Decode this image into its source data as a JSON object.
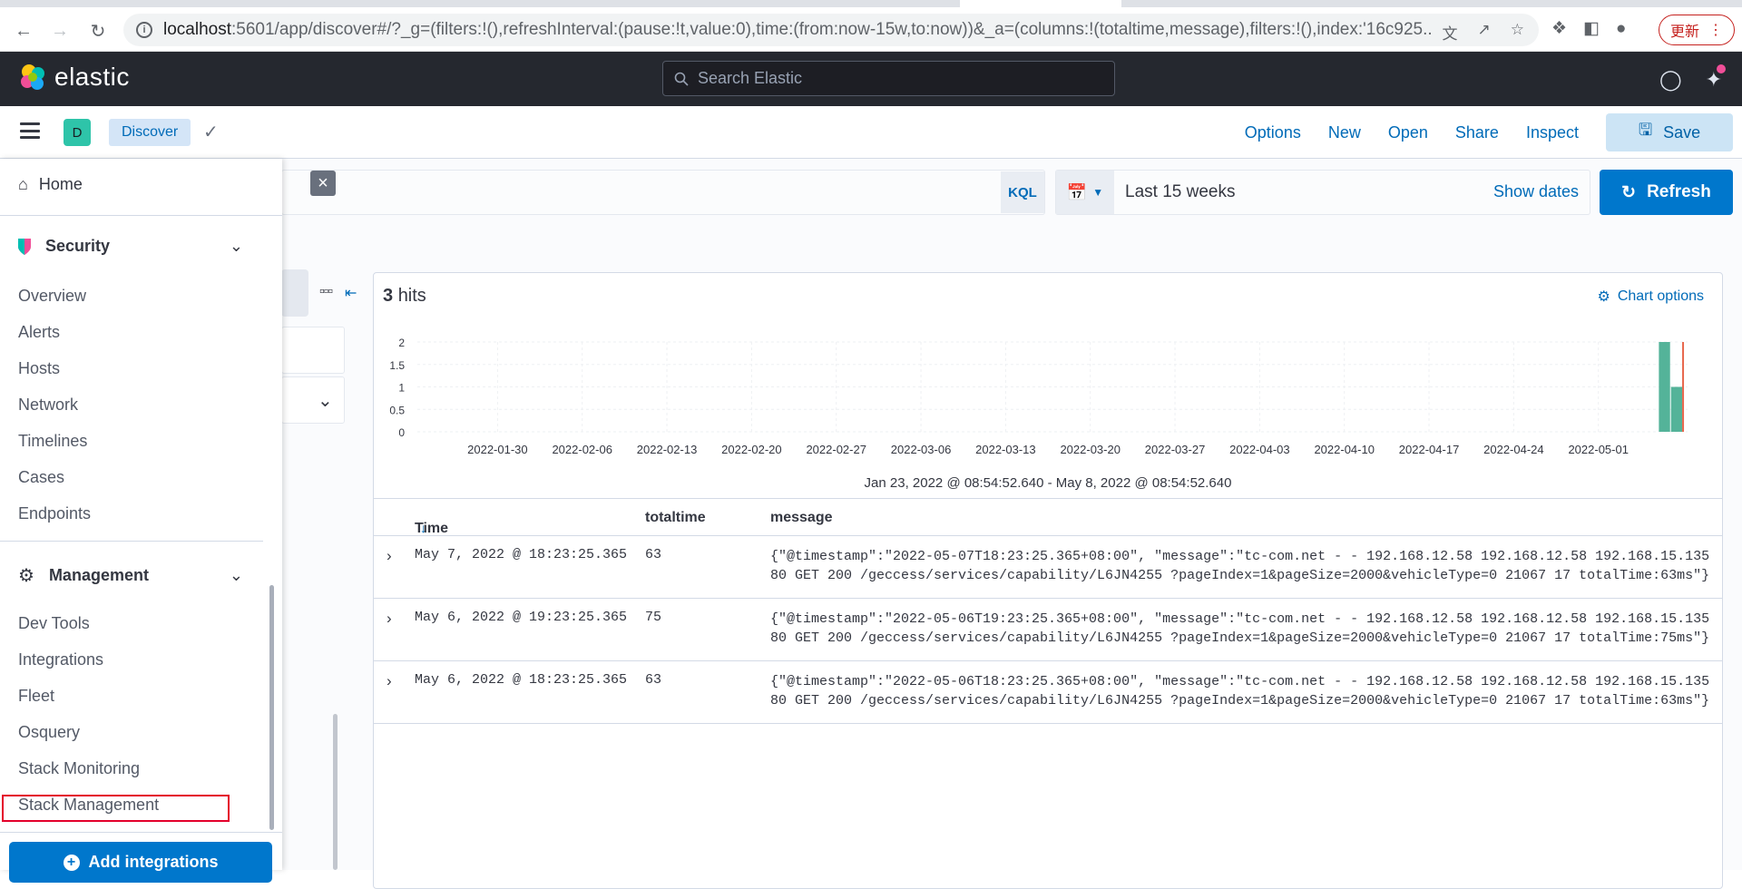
{
  "browser": {
    "url_host": "localhost",
    "url_rest": ":5601/app/discover#/?_g=(filters:!(),refreshInterval:(pause:!t,value:0),time:(from:now-15w,to:now))&_a=(columns:!(totaltime,message),filters:!(),index:'16c925...",
    "update_label": "更新"
  },
  "header": {
    "brand": "elastic",
    "search_placeholder": "Search Elastic"
  },
  "appbar": {
    "space_initial": "D",
    "breadcrumb": "Discover",
    "menu": [
      "Options",
      "New",
      "Open",
      "Share",
      "Inspect"
    ],
    "save_label": "Save"
  },
  "query": {
    "language": "KQL",
    "time_label": "Last 15 weeks",
    "show_dates": "Show dates",
    "refresh_label": "Refresh"
  },
  "results": {
    "hits_count": "3",
    "hits_label": "hits",
    "chart_options": "Chart options",
    "time_range": "Jan 23, 2022 @ 08:54:52.640 - May 8, 2022 @ 08:54:52.640",
    "columns": [
      "Time",
      "totaltime",
      "message"
    ],
    "rows": [
      {
        "time": "May 7, 2022 @ 18:23:25.365",
        "totaltime": "63",
        "message": "{\"@timestamp\":\"2022-05-07T18:23:25.365+08:00\", \"message\":\"tc-com.net - - 192.168.12.58 192.168.12.58 192.168.15.135 80 GET 200 /geccess/services/capability/L6JN4255 ?pageIndex=1&pageSize=2000&vehicleType=0 21067 17 totalTime:63ms\"}"
      },
      {
        "time": "May 6, 2022 @ 19:23:25.365",
        "totaltime": "75",
        "message": "{\"@timestamp\":\"2022-05-06T19:23:25.365+08:00\", \"message\":\"tc-com.net - - 192.168.12.58 192.168.12.58 192.168.15.135 80 GET 200 /geccess/services/capability/L6JN4255 ?pageIndex=1&pageSize=2000&vehicleType=0 21067 17 totalTime:75ms\"}"
      },
      {
        "time": "May 6, 2022 @ 18:23:25.365",
        "totaltime": "63",
        "message": "{\"@timestamp\":\"2022-05-06T18:23:25.365+08:00\", \"message\":\"tc-com.net - - 192.168.12.58 192.168.12.58 192.168.15.135 80 GET 200 /geccess/services/capability/L6JN4255 ?pageIndex=1&pageSize=2000&vehicleType=0 21067 17 totalTime:63ms\"}"
      }
    ]
  },
  "chart_data": {
    "type": "bar",
    "x_ticks": [
      "2022-01-30",
      "2022-02-06",
      "2022-02-13",
      "2022-02-20",
      "2022-02-27",
      "2022-03-06",
      "2022-03-13",
      "2022-03-20",
      "2022-03-27",
      "2022-04-03",
      "2022-04-10",
      "2022-04-17",
      "2022-04-24",
      "2022-05-01"
    ],
    "y_ticks": [
      0,
      0.5,
      1,
      1.5,
      2
    ],
    "ylim": [
      0,
      2
    ],
    "bars": [
      {
        "x": "2022-05-06",
        "value": 2
      },
      {
        "x": "2022-05-07",
        "value": 1
      }
    ],
    "now_marker": "2022-05-08",
    "grid": true,
    "bar_color": "#54b399",
    "marker_color": "#e7664c"
  },
  "nav": {
    "home": "Home",
    "security_title": "Security",
    "security_items": [
      "Overview",
      "Alerts",
      "Hosts",
      "Network",
      "Timelines",
      "Cases",
      "Endpoints"
    ],
    "management_title": "Management",
    "management_items": [
      "Dev Tools",
      "Integrations",
      "Fleet",
      "Osquery",
      "Stack Monitoring",
      "Stack Management"
    ],
    "add_integrations": "Add integrations"
  }
}
